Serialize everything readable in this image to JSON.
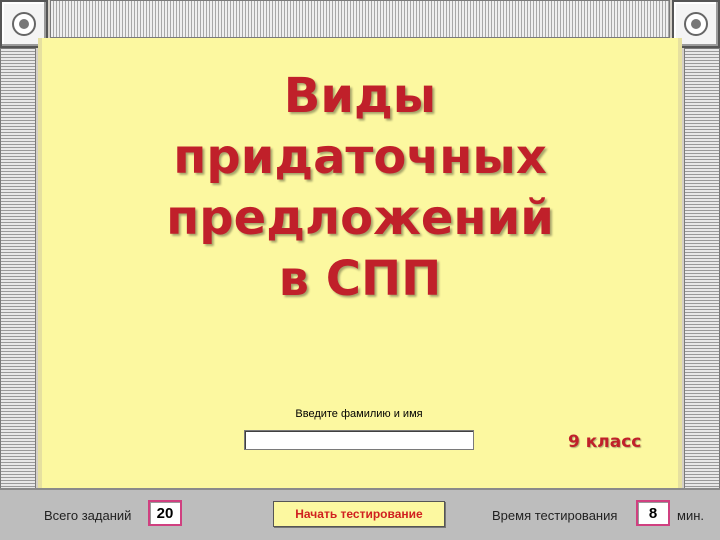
{
  "title_lines": [
    "Виды",
    "придаточных",
    "предложений",
    "в СПП"
  ],
  "name_prompt": "Введите фамилию и имя",
  "name_input": {
    "value": "",
    "placeholder": ""
  },
  "grade": "9  класс",
  "footer": {
    "total_tasks_label": "Всего заданий",
    "total_tasks_value": "20",
    "start_button_label": "Начать тестирование",
    "test_time_label": "Время тестирования",
    "test_time_value": "8",
    "time_unit": "мин."
  },
  "colors": {
    "accent": "#c0202a",
    "panel": "#fcf8a0",
    "box_border": "#d04080"
  },
  "icons": {
    "top_left": "radio-button-icon",
    "top_right": "radio-button-icon"
  }
}
